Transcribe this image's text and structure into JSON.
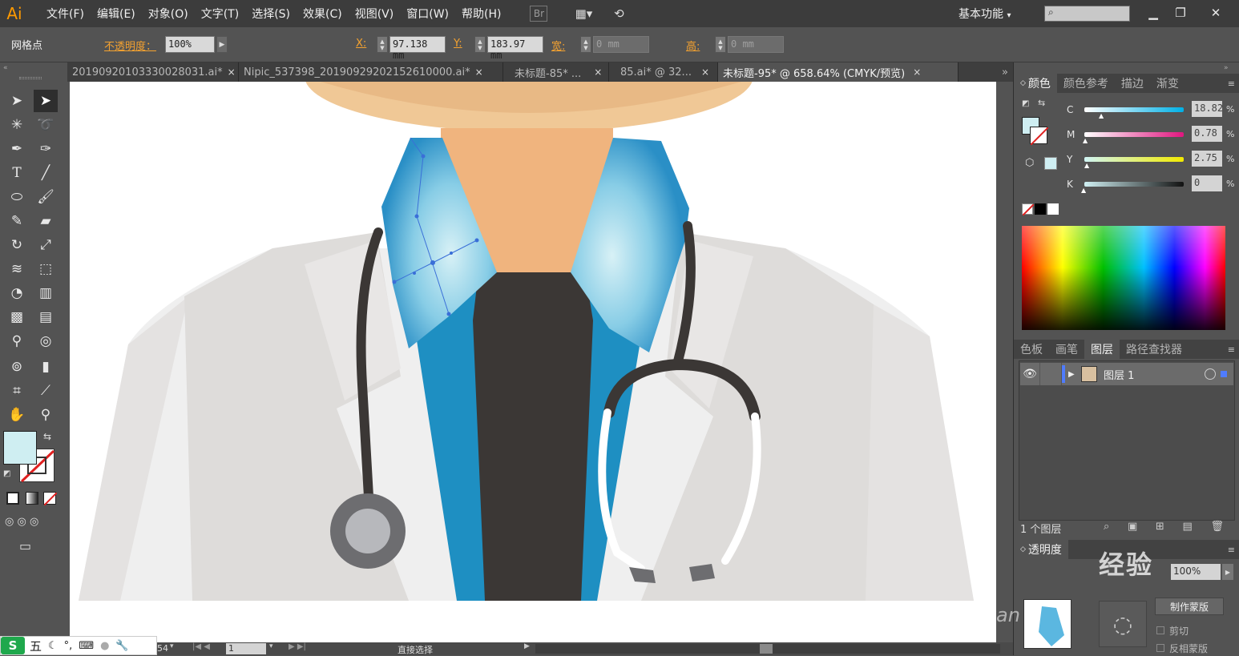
{
  "app": {
    "logo": "Ai"
  },
  "menu": [
    "文件(F)",
    "编辑(E)",
    "对象(O)",
    "文字(T)",
    "选择(S)",
    "效果(C)",
    "视图(V)",
    "窗口(W)",
    "帮助(H)"
  ],
  "menu_extras": {
    "bridge": "Br",
    "workspace": "基本功能",
    "workspace_arrow": "▾"
  },
  "control": {
    "selection_label": "网格点",
    "opacity_label": "不透明度：",
    "opacity_value": "100%",
    "x_label": "X:",
    "x_value": "97.138 mm",
    "y_label": "Y:",
    "y_value": "183.97 mm",
    "w_label": "宽:",
    "w_value": "0 mm",
    "h_label": "高:",
    "h_value": "0 mm"
  },
  "tabs": [
    {
      "label": "20190920103330028031.ai*",
      "active": false
    },
    {
      "label": "Nipic_537398_20190929202152610000.ai*",
      "active": false
    },
    {
      "label": "未标题-85* ...",
      "active": false
    },
    {
      "label": "85.ai* @ 32...",
      "active": false
    },
    {
      "label": "未标题-95* @ 658.64% (CMYK/预览)",
      "active": true
    }
  ],
  "tab_close": "×",
  "tab_overflow": "»",
  "color_panel": {
    "tabs": [
      "颜色",
      "颜色参考",
      "描边",
      "渐变"
    ],
    "channels": [
      {
        "name": "C",
        "value": "18.82"
      },
      {
        "name": "M",
        "value": "0.78"
      },
      {
        "name": "Y",
        "value": "2.75"
      },
      {
        "name": "K",
        "value": "0"
      }
    ],
    "percent": "%",
    "fill_color": "#cfeef2"
  },
  "layers_panel": {
    "tabs": [
      "色板",
      "画笔",
      "图层",
      "路径查找器"
    ],
    "layer_name": "图层 1",
    "layer_count": "1 个图层"
  },
  "transparency_panel": {
    "label": "透明度",
    "opacity_value": "100%",
    "make_mask": "制作蒙版",
    "clip": "剪切",
    "invert_mask": "反相蒙版"
  },
  "statusbar": {
    "zoom_fragment": "54",
    "page": "1",
    "tool": "直接选择"
  },
  "ime": {
    "label": "五"
  },
  "watermark": {
    "text": "经验",
    "sub": "jingyan"
  }
}
